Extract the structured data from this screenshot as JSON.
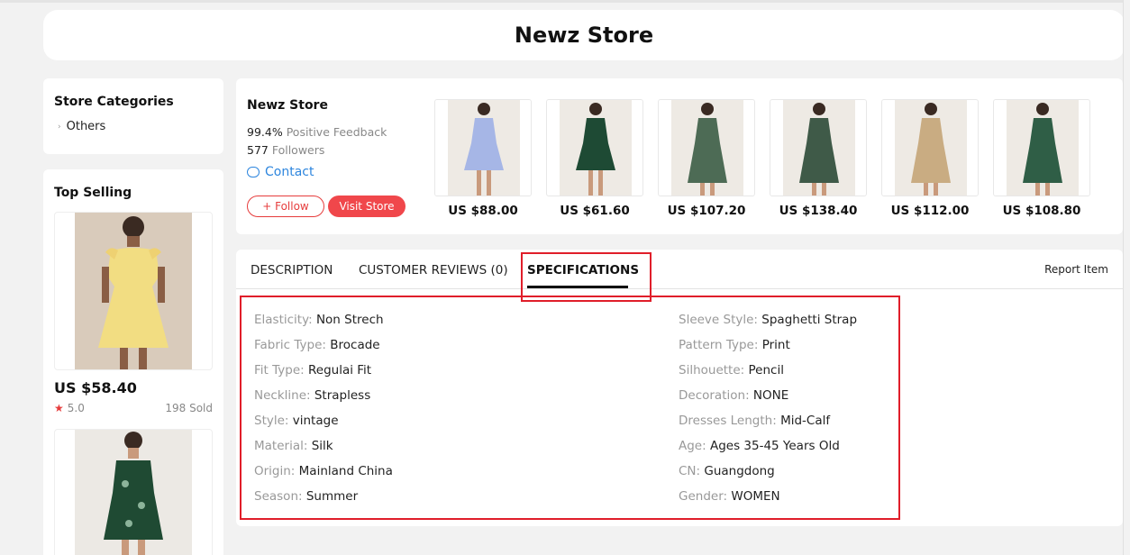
{
  "store": {
    "title": "Newz Store"
  },
  "sidebar": {
    "categories_title": "Store Categories",
    "categories": [
      {
        "label": "Others"
      }
    ],
    "top_selling_title": "Top Selling",
    "top_selling": [
      {
        "price": "US $58.40",
        "rating": "5.0",
        "sold": "198 Sold",
        "dress_color": "#f4e28c"
      },
      {
        "price": "",
        "rating": "",
        "sold": "",
        "dress_color": "#1f4a33"
      }
    ]
  },
  "store_info": {
    "name": "Newz Store",
    "feedback_value": "99.4%",
    "feedback_label": "Positive Feedback",
    "followers_value": "577",
    "followers_label": "Followers",
    "contact_label": "Contact",
    "follow_label": "+ Follow",
    "visit_label": "Visit Store"
  },
  "products": [
    {
      "price": "US $88.00",
      "dress_color": "#a6b6e6"
    },
    {
      "price": "US $61.60",
      "dress_color": "#1e4a34"
    },
    {
      "price": "US $107.20",
      "dress_color": "#4d6b55"
    },
    {
      "price": "US $138.40",
      "dress_color": "#3f5a48"
    },
    {
      "price": "US $112.00",
      "dress_color": "#c9ac82"
    },
    {
      "price": "US $108.80",
      "dress_color": "#2f5e46"
    }
  ],
  "tabs": {
    "items": [
      {
        "label": "DESCRIPTION"
      },
      {
        "label": "CUSTOMER REVIEWS (0)"
      },
      {
        "label": "SPECIFICATIONS"
      }
    ],
    "active": "SPECIFICATIONS",
    "report_label": "Report Item"
  },
  "specifications": {
    "left": [
      {
        "key": "Elasticity:",
        "value": "Non Strech"
      },
      {
        "key": "Fabric Type:",
        "value": "Brocade"
      },
      {
        "key": "Fit Type:",
        "value": "Regulai Fit"
      },
      {
        "key": "Neckline:",
        "value": "Strapless"
      },
      {
        "key": "Style:",
        "value": "vintage"
      },
      {
        "key": "Material:",
        "value": "Silk"
      },
      {
        "key": "Origin:",
        "value": "Mainland China"
      },
      {
        "key": "Season:",
        "value": "Summer"
      }
    ],
    "right": [
      {
        "key": "Sleeve Style:",
        "value": "Spaghetti Strap"
      },
      {
        "key": "Pattern Type:",
        "value": "Print"
      },
      {
        "key": "Silhouette:",
        "value": "Pencil"
      },
      {
        "key": "Decoration:",
        "value": "NONE"
      },
      {
        "key": "Dresses Length:",
        "value": "Mid-Calf"
      },
      {
        "key": "Age:",
        "value": "Ages 35-45 Years Old"
      },
      {
        "key": "CN:",
        "value": "Guangdong"
      },
      {
        "key": "Gender:",
        "value": "WOMEN"
      }
    ]
  },
  "colors": {
    "accent": "#f0474b",
    "link": "#2e86de",
    "highlight": "#e01e2a"
  }
}
